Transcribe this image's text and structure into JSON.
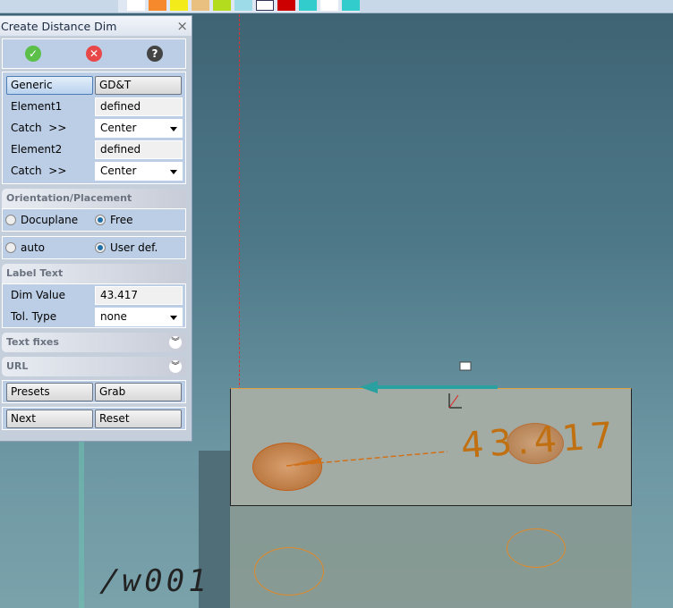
{
  "dialog": {
    "title": "Create Distance Dim",
    "close": "×",
    "tabs": {
      "generic": "Generic",
      "gdt": "GD&T"
    },
    "element1": {
      "label": "Element1",
      "value": "defined"
    },
    "catch1": {
      "label": "Catch  >>",
      "value": "Center"
    },
    "element2": {
      "label": "Element2",
      "value": "defined"
    },
    "catch2": {
      "label": "Catch  >>",
      "value": "Center"
    },
    "orientation": {
      "title": "Orientation/Placement",
      "docuplane": "Docuplane",
      "free": "Free"
    },
    "placement": {
      "auto": "auto",
      "userdef": "User def."
    },
    "label_text": {
      "title": "Label Text",
      "dim_label": "Dim Value",
      "dim_value": "43.417",
      "tol_label": "Tol. Type",
      "tol_value": "none"
    },
    "text_fixes": "Text fixes",
    "url": "URL",
    "buttons": {
      "presets": "Presets",
      "grab": "Grab",
      "next": "Next",
      "reset": "Reset"
    }
  },
  "viewport": {
    "dim_text": "43.417",
    "face_label": "/w001"
  }
}
